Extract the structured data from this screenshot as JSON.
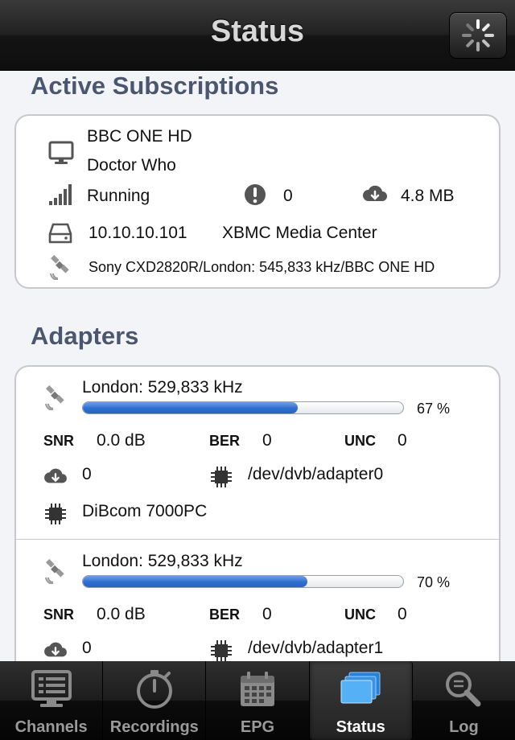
{
  "header": {
    "title": "Status",
    "refresh_icon": "spinner-icon"
  },
  "subscriptions": {
    "section_title": "Active Subscriptions",
    "items": [
      {
        "channel": "BBC ONE HD",
        "program": "Doctor Who",
        "state": "Running",
        "errors": "0",
        "bandwidth": "4.8 MB",
        "host": "10.10.10.101",
        "client": "XBMC Media Center",
        "service": "Sony CXD2820R/London: 545,833 kHz/BBC ONE HD"
      }
    ]
  },
  "adapters": {
    "section_title": "Adapters",
    "snr_label": "SNR",
    "ber_label": "BER",
    "unc_label": "UNC",
    "items": [
      {
        "mux": "London: 529,833 kHz",
        "signal_percent": 67,
        "signal_text": "67 %",
        "snr": "0.0 dB",
        "ber": "0",
        "unc": "0",
        "bandwidth": "0",
        "device": "/dev/dvb/adapter0",
        "name": "DiBcom 7000PC"
      },
      {
        "mux": "London: 529,833 kHz",
        "signal_percent": 70,
        "signal_text": "70 %",
        "snr": "0.0 dB",
        "ber": "0",
        "unc": "0",
        "bandwidth": "0",
        "device": "/dev/dvb/adapter1"
      }
    ]
  },
  "tabs": [
    {
      "label": "Channels",
      "icon": "tv-list-icon",
      "selected": false
    },
    {
      "label": "Recordings",
      "icon": "timer-icon",
      "selected": false
    },
    {
      "label": "EPG",
      "icon": "calendar-icon",
      "selected": false
    },
    {
      "label": "Status",
      "icon": "status-stack-icon",
      "selected": true
    },
    {
      "label": "Log",
      "icon": "magnifier-icon",
      "selected": false
    }
  ],
  "colors": {
    "accent_blue": "#2f6fd0",
    "section_title": "#4b5670"
  }
}
